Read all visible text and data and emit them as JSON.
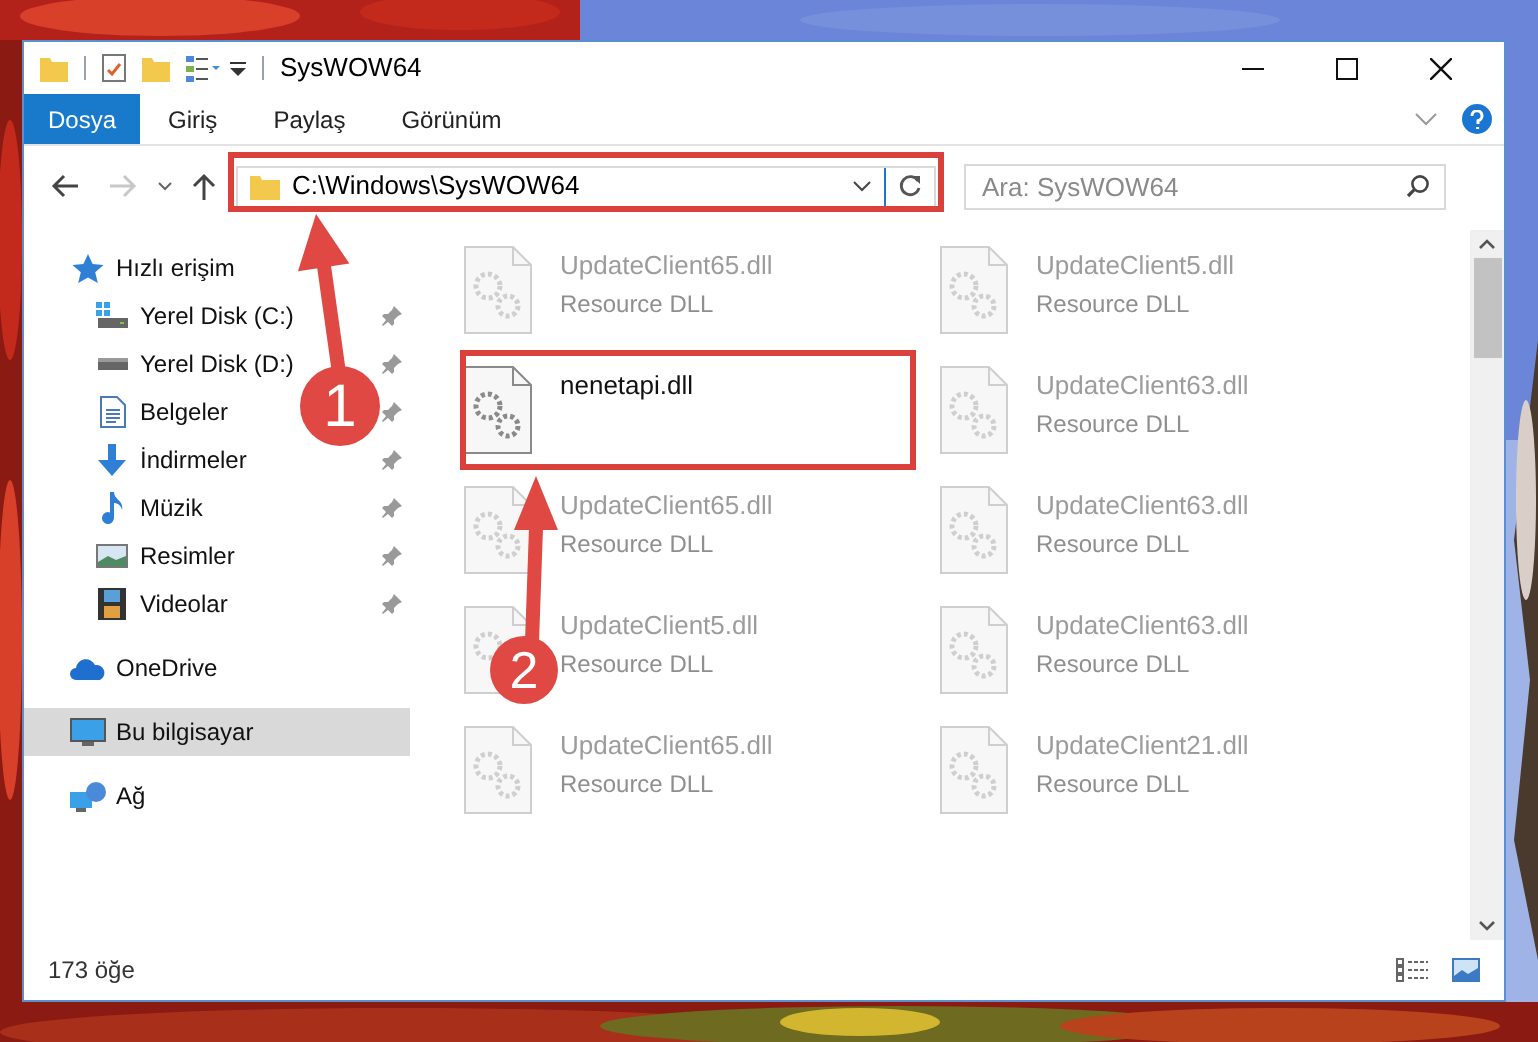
{
  "window": {
    "title": "SysWOW64"
  },
  "tabs": [
    {
      "label": "Dosya",
      "selected": true
    },
    {
      "label": "Giriş",
      "selected": false
    },
    {
      "label": "Paylaş",
      "selected": false
    },
    {
      "label": "Görünüm",
      "selected": false
    }
  ],
  "address": {
    "value": "C:\\Windows\\SysWOW64"
  },
  "search": {
    "placeholder": "Ara: SysWOW64"
  },
  "sidebar": [
    {
      "label": "Hızlı erişim",
      "kind": "star",
      "selected": false,
      "children": [
        {
          "label": "Yerel Disk (C:)",
          "kind": "system-drive",
          "pinned": true
        },
        {
          "label": "Yerel Disk (D:)",
          "kind": "drive",
          "pinned": true
        },
        {
          "label": "Belgeler",
          "kind": "document",
          "pinned": true
        },
        {
          "label": "İndirmeler",
          "kind": "download",
          "pinned": true
        },
        {
          "label": "Müzik",
          "kind": "music",
          "pinned": true
        },
        {
          "label": "Resimler",
          "kind": "pictures",
          "pinned": true
        },
        {
          "label": "Videolar",
          "kind": "video",
          "pinned": true
        }
      ]
    },
    {
      "label": "OneDrive",
      "kind": "cloud",
      "selected": false
    },
    {
      "label": "Bu bilgisayar",
      "kind": "computer",
      "selected": true
    },
    {
      "label": "Ağ",
      "kind": "network",
      "selected": false
    }
  ],
  "files": [
    {
      "name": "UpdateClient65.dll",
      "type": "Resource DLL",
      "dimmed": true
    },
    {
      "name": "UpdateClient5.dll",
      "type": "Resource DLL",
      "dimmed": true
    },
    {
      "name": "nenetapi.dll",
      "dimmed": false
    },
    {
      "name": "UpdateClient63.dll",
      "type": "Resource DLL",
      "dimmed": true
    },
    {
      "name": "UpdateClient65.dll",
      "type": "Resource DLL",
      "dimmed": true
    },
    {
      "name": "UpdateClient63.dll",
      "type": "Resource DLL",
      "dimmed": true
    },
    {
      "name": "UpdateClient5.dll",
      "type": "Resource DLL",
      "dimmed": true
    },
    {
      "name": "UpdateClient63.dll",
      "type": "Resource DLL",
      "dimmed": true
    },
    {
      "name": "UpdateClient65.dll",
      "type": "Resource DLL",
      "dimmed": true
    },
    {
      "name": "UpdateClient21.dll",
      "type": "Resource DLL",
      "dimmed": true
    }
  ],
  "status_bar": {
    "item_count": "173 öğe"
  },
  "annotations": [
    {
      "label": "1"
    },
    {
      "label": "2"
    }
  ]
}
